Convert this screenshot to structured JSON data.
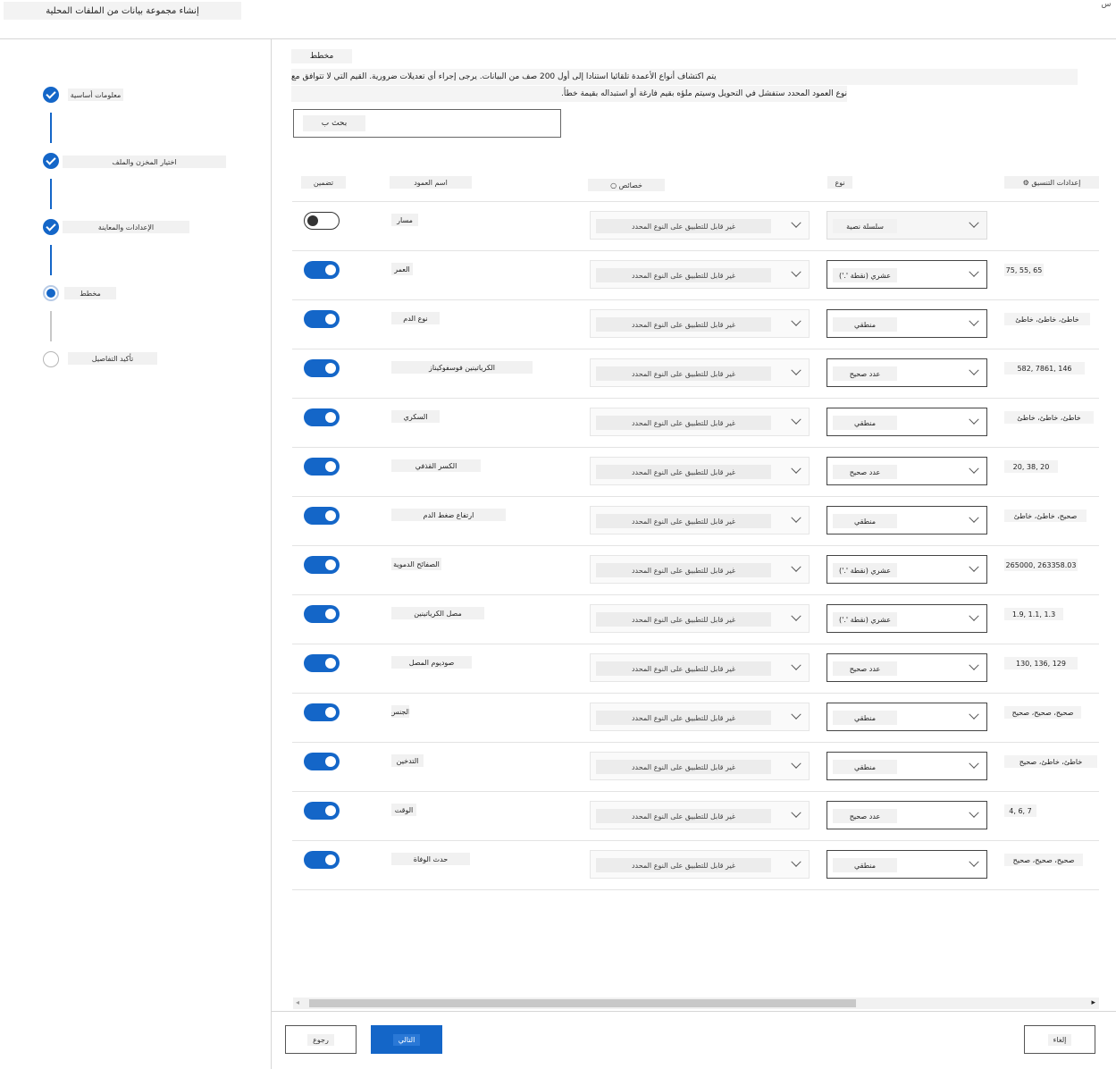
{
  "header": {
    "title": "إنشاء مجموعة بيانات من الملفات المحلية",
    "close_label": "س"
  },
  "steps": [
    {
      "label": "معلومات أساسية",
      "state": "done"
    },
    {
      "label": "اختيار المخزن والملف",
      "state": "done"
    },
    {
      "label": "الإعدادات والمعاينة",
      "state": "done"
    },
    {
      "label": "مخطط",
      "state": "current"
    },
    {
      "label": "تأكيد التفاصيل",
      "state": "todo"
    }
  ],
  "main": {
    "section_title": "مخطط",
    "description_1": "يتم اكتشاف أنواع الأعمدة تلقائيا استنادا إلى أول 200 صف من البيانات. يرجى إجراء أي تعديلات ضرورية. القيم التي لا تتوافق مع",
    "description_2": "نوع العمود المحدد ستفشل في التحويل وسيتم ملؤه بقيم فارغة أو استبداله بقيمة خطأ.",
    "search_label": "بحث ب"
  },
  "table": {
    "headers": {
      "include": "تضمين",
      "column_name": "اسم العمود",
      "properties": "خصائص ○",
      "type": "نوع",
      "format_settings": "إعدادات التنسيق ⚙"
    },
    "rows": [
      {
        "include": false,
        "name": "مسار",
        "property": "غير قابل للتطبيق على النوع المحدد",
        "type": "سلسلة نصية",
        "format": ""
      },
      {
        "include": true,
        "name": "العمر",
        "property": "غير قابل للتطبيق على النوع المحدد",
        "type": "عشري (نقطة '.')",
        "format": "75, 55, 65"
      },
      {
        "include": true,
        "name": "نوع الدم",
        "property": "غير قابل للتطبيق على النوع المحدد",
        "type": "منطقي",
        "format": "خاطئ، خاطئ، خاطئ"
      },
      {
        "include": true,
        "name": "الكرياتينين فوسفوكيناز",
        "property": "غير قابل للتطبيق على النوع المحدد",
        "type": "عدد صحيح",
        "format": "582, 7861, 146"
      },
      {
        "include": true,
        "name": "السكري",
        "property": "غير قابل للتطبيق على النوع المحدد",
        "type": "منطقي",
        "format": "خاطئ، خاطئ، خاطئ"
      },
      {
        "include": true,
        "name": "الكسر القذفي",
        "property": "غير قابل للتطبيق على النوع المحدد",
        "type": "عدد صحيح",
        "format": "20, 38, 20"
      },
      {
        "include": true,
        "name": "ارتفاع ضغط الدم",
        "property": "غير قابل للتطبيق على النوع المحدد",
        "type": "منطقي",
        "format": "صحيح، خاطئ، خاطئ"
      },
      {
        "include": true,
        "name": "الصفائح الدموية",
        "property": "غير قابل للتطبيق على النوع المحدد",
        "type": "عشري (نقطة '.')",
        "format": "265000, 263358.03"
      },
      {
        "include": true,
        "name": "مصل الكرياتينين",
        "property": "غير قابل للتطبيق على النوع المحدد",
        "type": "عشري (نقطة '.')",
        "format": "1.9, 1.1, 1.3"
      },
      {
        "include": true,
        "name": "صوديوم المصل",
        "property": "غير قابل للتطبيق على النوع المحدد",
        "type": "عدد صحيح",
        "format": "130, 136, 129"
      },
      {
        "include": true,
        "name": "الجنس",
        "property": "غير قابل للتطبيق على النوع المحدد",
        "type": "منطقي",
        "format": "صحيح، صحيح، صحيح"
      },
      {
        "include": true,
        "name": "التدخين",
        "property": "غير قابل للتطبيق على النوع المحدد",
        "type": "منطقي",
        "format": "خاطئ، خاطئ، صحيح"
      },
      {
        "include": true,
        "name": "الوقت",
        "property": "غير قابل للتطبيق على النوع المحدد",
        "type": "عدد صحيح",
        "format": "4, 6, 7"
      },
      {
        "include": true,
        "name": "حدث الوفاة",
        "property": "غير قابل للتطبيق على النوع المحدد",
        "type": "منطقي",
        "format": "صحيح، صحيح، صحيح"
      }
    ]
  },
  "footer": {
    "back_label": "رجوع",
    "next_label": "التالي",
    "cancel_label": "إلغاء"
  },
  "colors": {
    "accent": "#1466c8"
  }
}
